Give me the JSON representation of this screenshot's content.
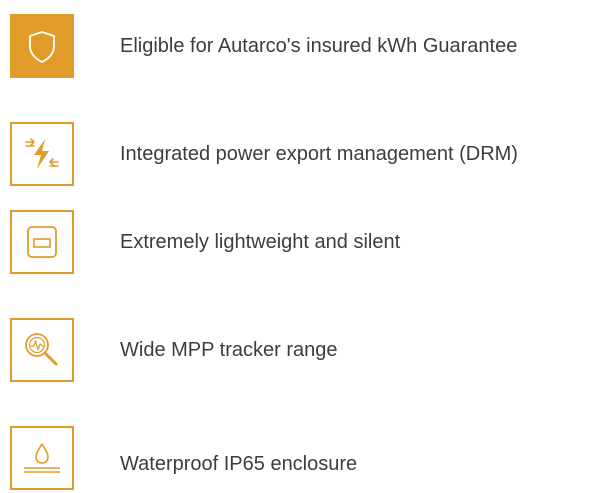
{
  "colors": {
    "accent": "#E19B29",
    "text": "#3d3d3d",
    "background": "#ffffff"
  },
  "features": [
    {
      "icon": "shield-icon",
      "label": "Eligible for Autarco's insured kWh Guarantee"
    },
    {
      "icon": "power-export-icon",
      "label": "Integrated power export management (DRM)"
    },
    {
      "icon": "device-icon",
      "label": "Extremely lightweight and silent"
    },
    {
      "icon": "magnifier-icon",
      "label": "Wide MPP tracker range"
    },
    {
      "icon": "water-drop-icon",
      "label": "Waterproof IP65 enclosure"
    }
  ]
}
